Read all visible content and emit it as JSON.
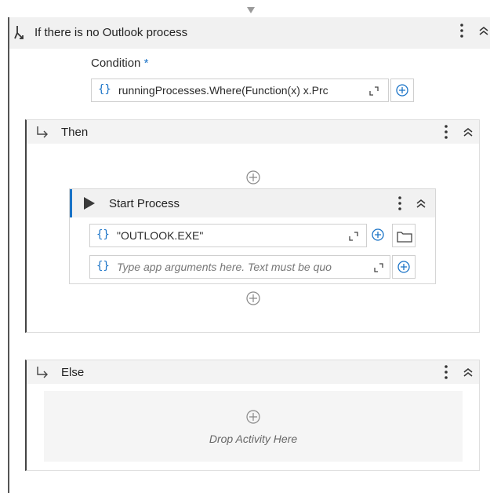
{
  "if_activity": {
    "title": "If there is no Outlook process",
    "condition_label": "Condition",
    "required_mark": "*",
    "condition_value": "runningProcesses.Where(Function(x) x.Prc"
  },
  "then_branch": {
    "label": "Then"
  },
  "start_process": {
    "title": "Start Process",
    "file_name_value": "\"OUTLOOK.EXE\"",
    "arguments_placeholder": "Type app arguments here. Text must be quo"
  },
  "else_branch": {
    "label": "Else",
    "drop_hint": "Drop Activity Here"
  },
  "icons": {
    "expression": "{}",
    "kebab": "⋮",
    "collapse": "chevron-double-up",
    "add": "plus-circle",
    "expand": "expand-editor",
    "folder": "folder",
    "branch": "branch-arrow",
    "if": "if-split",
    "play": "play-triangle"
  }
}
